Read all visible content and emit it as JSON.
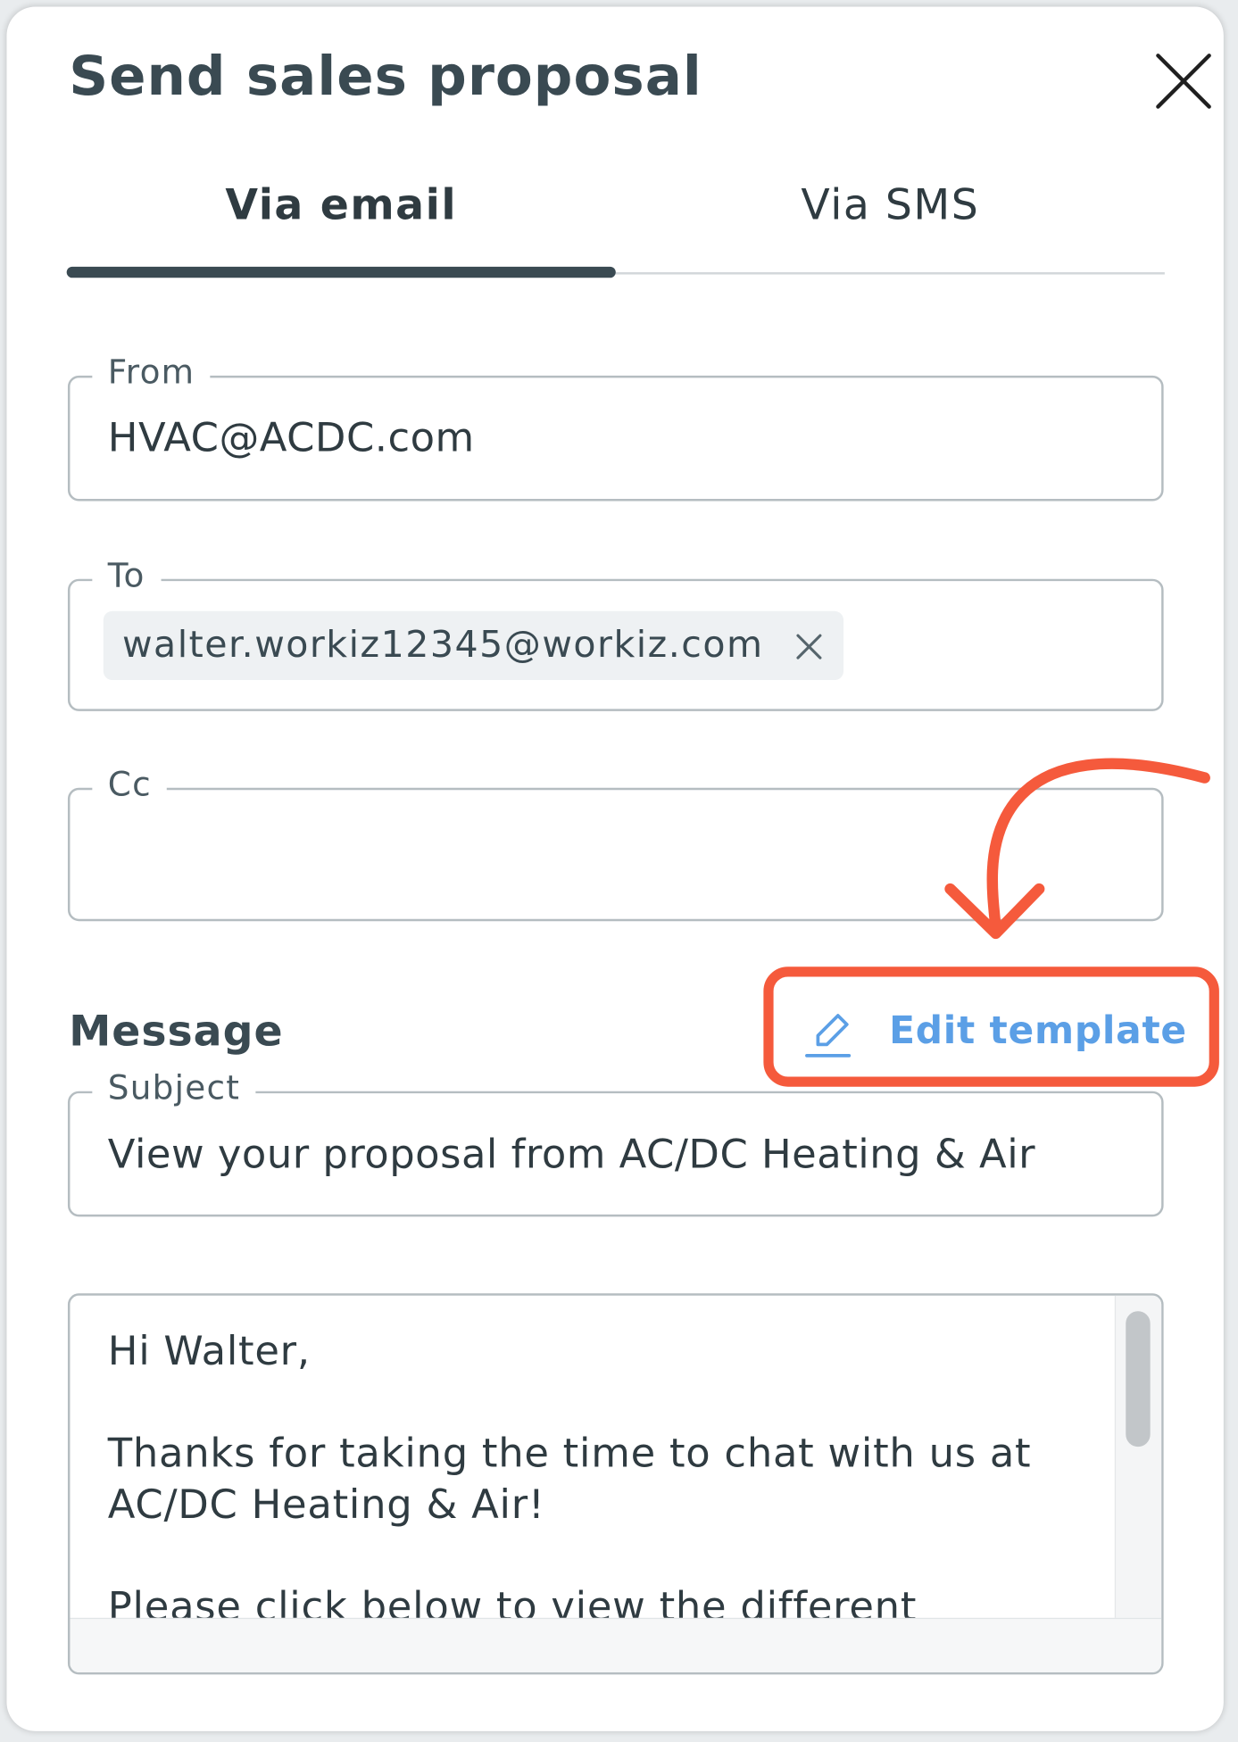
{
  "dialog": {
    "title": "Send sales proposal"
  },
  "tabs": [
    {
      "label": "Via email",
      "selected": true
    },
    {
      "label": "Via SMS",
      "selected": false
    }
  ],
  "from": {
    "label": "From",
    "value": "HVAC@ACDC.com"
  },
  "to": {
    "label": "To",
    "recipients": [
      "walter.workiz12345@workiz.com"
    ]
  },
  "cc": {
    "label": "Cc",
    "value": ""
  },
  "message": {
    "heading": "Message",
    "edit_template_label": "Edit template",
    "subject_label": "Subject",
    "subject_value": "View your proposal from AC/DC Heating & Air",
    "body": "Hi Walter,\n\nThanks for taking the time to chat with us at AC/DC Heating & Air!\n\nPlease click below to view the different"
  },
  "icons": {
    "close": "close-icon",
    "chip_remove": "close-icon",
    "edit": "pencil-icon"
  },
  "colors": {
    "accent_link": "#5b9fe6",
    "annotation": "#f55a3c",
    "heading_text": "#3a4a52"
  }
}
